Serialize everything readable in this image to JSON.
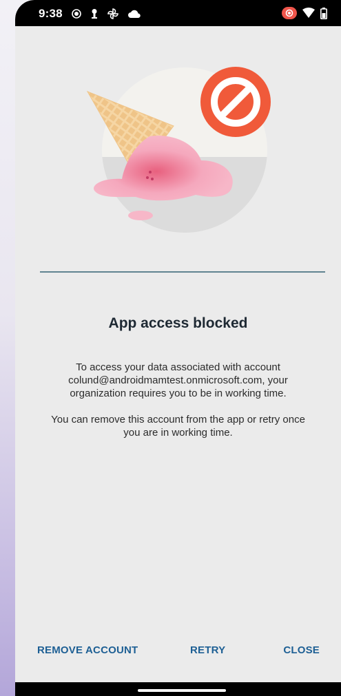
{
  "status_bar": {
    "time": "9:38",
    "icons_left": [
      "record-icon",
      "key-icon",
      "pinwheel-icon",
      "cloud-icon"
    ],
    "icons_right": [
      "cast-icon",
      "wifi-icon",
      "battery-icon"
    ]
  },
  "dialog": {
    "title": "App access blocked",
    "message1": "To access your data associated with account colund@androidmamtest.onmicrosoft.com, your organization requires you to be in working time.",
    "message2": "You can remove this account from the app or retry once you are in working time."
  },
  "actions": {
    "remove_label": "REMOVE ACCOUNT",
    "retry_label": "RETRY",
    "close_label": "CLOSE"
  },
  "colors": {
    "background": "#ebebeb",
    "accent": "#1d5f94",
    "block_icon": "#f05a3a",
    "divider": "#5f8390"
  }
}
